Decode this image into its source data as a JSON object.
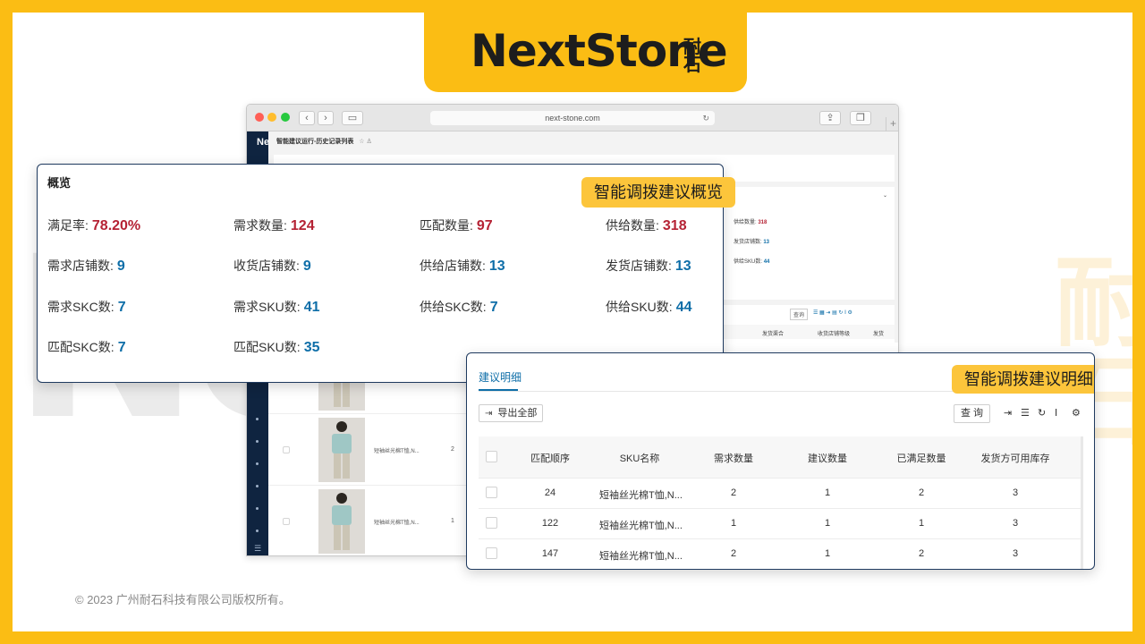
{
  "brand": {
    "name": "NextStone",
    "name_cn": "耐石"
  },
  "footer": "© 2023 广州耐石科技有限公司版权所有。",
  "browser": {
    "url": "next-stone.com",
    "app_brand": "Ne",
    "page_title": "智能建议运行-历史记录列表",
    "bg": {
      "supply_qty_label": "供给数量:",
      "supply_qty": "318",
      "ship_store_label": "发货店铺数:",
      "ship_store": "13",
      "supply_sku_label": "供给SKU数:",
      "supply_sku": "44",
      "query": "查询",
      "col_a": "发货渠合",
      "col_b": "收货店铺等级",
      "col_c": "发货"
    },
    "rows": [
      {
        "name": "短袖丝光棉T恤,N...",
        "qty": "2"
      },
      {
        "name": "短袖丝光棉T恤,N...",
        "qty": "1"
      }
    ]
  },
  "overview": {
    "title": "概览",
    "badge": "智能调拨建议概览",
    "stats": [
      {
        "label": "满足率:",
        "value": "78.20%",
        "color": "red"
      },
      {
        "label": "需求数量:",
        "value": "124",
        "color": "red"
      },
      {
        "label": "匹配数量:",
        "value": "97",
        "color": "red"
      },
      {
        "label": "供给数量:",
        "value": "318",
        "color": "red"
      },
      {
        "label": "需求店铺数:",
        "value": "9",
        "color": "blue"
      },
      {
        "label": "收货店铺数:",
        "value": "9",
        "color": "blue"
      },
      {
        "label": "供给店铺数:",
        "value": "13",
        "color": "blue"
      },
      {
        "label": "发货店铺数:",
        "value": "13",
        "color": "blue"
      },
      {
        "label": "需求SKC数:",
        "value": "7",
        "color": "blue"
      },
      {
        "label": "需求SKU数:",
        "value": "41",
        "color": "blue"
      },
      {
        "label": "供给SKC数:",
        "value": "7",
        "color": "blue"
      },
      {
        "label": "供给SKU数:",
        "value": "44",
        "color": "blue"
      },
      {
        "label": "匹配SKC数:",
        "value": "7",
        "color": "blue"
      },
      {
        "label": "匹配SKU数:",
        "value": "35",
        "color": "blue"
      }
    ]
  },
  "detail": {
    "tab": "建议明细",
    "badge": "智能调拨建议明细",
    "export": "导出全部",
    "query": "查 询",
    "columns": [
      "匹配顺序",
      "SKU名称",
      "需求数量",
      "建议数量",
      "已满足数量",
      "发货方可用库存"
    ],
    "rows": [
      [
        "24",
        "短袖丝光棉T恤,N...",
        "2",
        "1",
        "2",
        "3"
      ],
      [
        "122",
        "短袖丝光棉T恤,N...",
        "1",
        "1",
        "1",
        "3"
      ],
      [
        "147",
        "短袖丝光棉T恤,N...",
        "2",
        "1",
        "2",
        "3"
      ]
    ]
  },
  "colors": {
    "accent": "#fbbd14",
    "red": "#b52234",
    "blue": "#0e6ea8",
    "navy": "#0f2440"
  }
}
